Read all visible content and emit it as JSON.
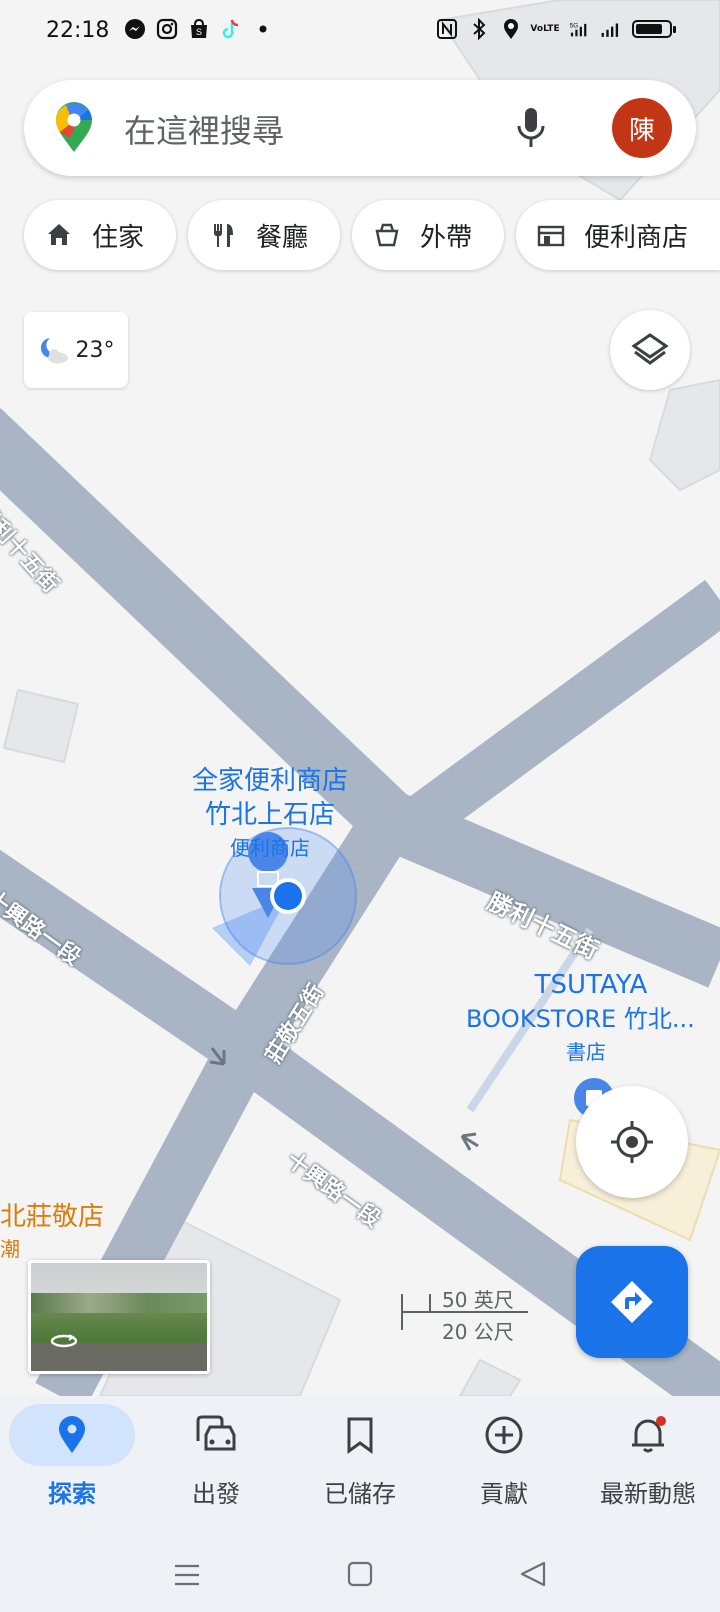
{
  "status_bar": {
    "time": "22:18",
    "left_icons": [
      "messenger-icon",
      "instagram-icon",
      "shopee-icon",
      "tiktok-icon",
      "dot-icon"
    ],
    "right_icons": [
      "nfc-icon",
      "bluetooth-icon",
      "location-icon",
      "volte-icon",
      "5g-signal-icon",
      "signal-icon",
      "battery-icon"
    ],
    "volte_text": "VoLTE",
    "net_text": "5G"
  },
  "search": {
    "placeholder": "在這裡搜尋",
    "avatar_initial": "陳"
  },
  "chips": [
    {
      "label": "住家",
      "icon": "home-icon"
    },
    {
      "label": "餐廳",
      "icon": "restaurant-icon"
    },
    {
      "label": "外帶",
      "icon": "takeout-icon"
    },
    {
      "label": "便利商店",
      "icon": "store-icon"
    }
  ],
  "weather": {
    "temp": "23°",
    "icon": "partly-cloudy-night-icon"
  },
  "map": {
    "poi_familymart": {
      "name_line1": "全家便利商店",
      "name_line2": "竹北上石店",
      "category": "便利商店"
    },
    "poi_tsutaya": {
      "name_line1": "TSUTAYA",
      "name_line2": "BOOKSTORE 竹北...",
      "category": "書店"
    },
    "poi_left": {
      "name": "北莊敬店",
      "sub": "潮"
    },
    "roads": {
      "shengli_top": "勝利十五街",
      "shengli_right": "勝利十五街",
      "shixing_left": "十興路一段",
      "shixing_bottom": "十興路一段",
      "zhuangjing": "莊敬五街"
    },
    "scale": {
      "imperial": "50 英尺",
      "metric": "20 公尺"
    }
  },
  "bottom_nav": [
    {
      "label": "探索",
      "icon": "explore-pin-icon",
      "active": true
    },
    {
      "label": "出發",
      "icon": "commute-icon",
      "active": false
    },
    {
      "label": "已儲存",
      "icon": "bookmark-icon",
      "active": false
    },
    {
      "label": "貢獻",
      "icon": "add-circle-icon",
      "active": false
    },
    {
      "label": "最新動態",
      "icon": "bell-icon",
      "active": false
    }
  ],
  "colors": {
    "accent": "#1a73e8",
    "road": "#a9b5c4",
    "avatar": "#c23616",
    "poi": "#1a73e8",
    "poi_orange": "#d97d0d"
  }
}
